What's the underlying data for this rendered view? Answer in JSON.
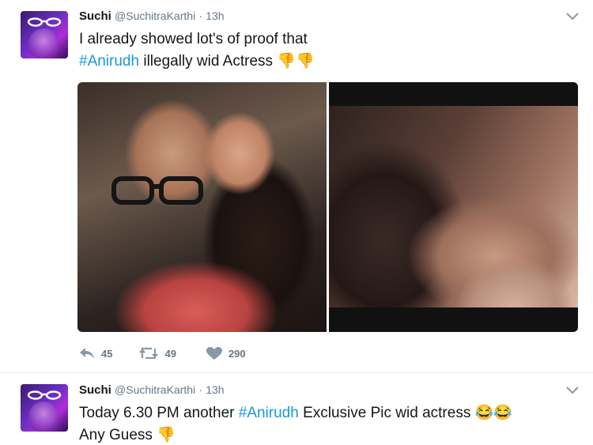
{
  "tweets": [
    {
      "name": "Suchi",
      "handle": "@SuchitraKarthi",
      "separator": "·",
      "time": "13h",
      "line1": "I already showed lot's of proof that",
      "hashtag": "#Anirudh",
      "line2_rest": " illegally wid Actress",
      "emojis": "👎👎",
      "actions": {
        "reply_count": "45",
        "retweet_count": "49",
        "like_count": "290"
      }
    },
    {
      "name": "Suchi",
      "handle": "@SuchitraKarthi",
      "separator": "·",
      "time": "13h",
      "line1_start": "Today 6.30 PM another ",
      "hashtag": "#Anirudh",
      "line1_rest": " Exclusive Pic wid actress ",
      "line1_emojis": "😂😂",
      "line2": "Any Guess",
      "line2_emoji": "👎"
    }
  ],
  "colors": {
    "link": "#1b95e0",
    "muted": "#657786",
    "text": "#14171a",
    "divider": "#e6ecf0"
  },
  "icons": [
    "avatar",
    "chevron-down-icon",
    "reply-icon",
    "retweet-icon",
    "heart-icon"
  ]
}
